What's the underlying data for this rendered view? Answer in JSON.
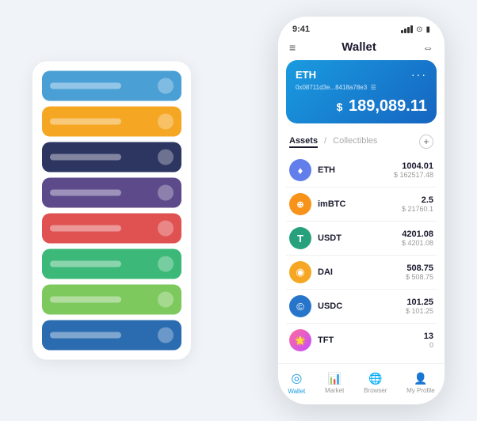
{
  "scene": {
    "background": "#f0f4f8"
  },
  "cardStack": {
    "cards": [
      {
        "color": "c-blue",
        "line": true,
        "dot": true
      },
      {
        "color": "c-yellow",
        "line": true,
        "dot": true
      },
      {
        "color": "c-dark",
        "line": true,
        "dot": true
      },
      {
        "color": "c-purple",
        "line": true,
        "dot": true
      },
      {
        "color": "c-red",
        "line": true,
        "dot": true
      },
      {
        "color": "c-green",
        "line": true,
        "dot": true
      },
      {
        "color": "c-lightgreen",
        "line": true,
        "dot": true
      },
      {
        "color": "c-royalblue",
        "line": true,
        "dot": true
      }
    ]
  },
  "phone": {
    "statusBar": {
      "time": "9:41",
      "icons": "signal wifi battery"
    },
    "header": {
      "menuIcon": "≡",
      "title": "Wallet",
      "scanIcon": "⇔"
    },
    "ethCard": {
      "label": "ETH",
      "dots": "···",
      "address": "0x08711d3e...8418a78e3",
      "addressSuffix": "☰",
      "dollarSign": "$",
      "balance": "189,089.11"
    },
    "assetsSection": {
      "activeTab": "Assets",
      "inactiveTab": "Collectibles",
      "addIcon": "+"
    },
    "assets": [
      {
        "name": "ETH",
        "icon": "♦",
        "iconBg": "#627eea",
        "iconColor": "white",
        "amount": "1004.01",
        "usd": "$ 162517.48"
      },
      {
        "name": "imBTC",
        "icon": "⊕",
        "iconBg": "#f7931a",
        "iconColor": "white",
        "amount": "2.5",
        "usd": "$ 21760.1"
      },
      {
        "name": "USDT",
        "icon": "T",
        "iconBg": "#26a17b",
        "iconColor": "white",
        "amount": "4201.08",
        "usd": "$ 4201.08"
      },
      {
        "name": "DAI",
        "icon": "◉",
        "iconBg": "#f5a623",
        "iconColor": "white",
        "amount": "508.75",
        "usd": "$ 508.75"
      },
      {
        "name": "USDC",
        "icon": "©",
        "iconBg": "#2775ca",
        "iconColor": "white",
        "amount": "101.25",
        "usd": "$ 101.25"
      },
      {
        "name": "TFT",
        "icon": "🌟",
        "iconBg": "#ff6b9d",
        "iconColor": "white",
        "amount": "13",
        "usd": "0"
      }
    ],
    "bottomNav": [
      {
        "icon": "◎",
        "label": "Wallet",
        "active": true
      },
      {
        "icon": "📈",
        "label": "Market",
        "active": false
      },
      {
        "icon": "🌐",
        "label": "Browser",
        "active": false
      },
      {
        "icon": "👤",
        "label": "My Profile",
        "active": false
      }
    ]
  }
}
